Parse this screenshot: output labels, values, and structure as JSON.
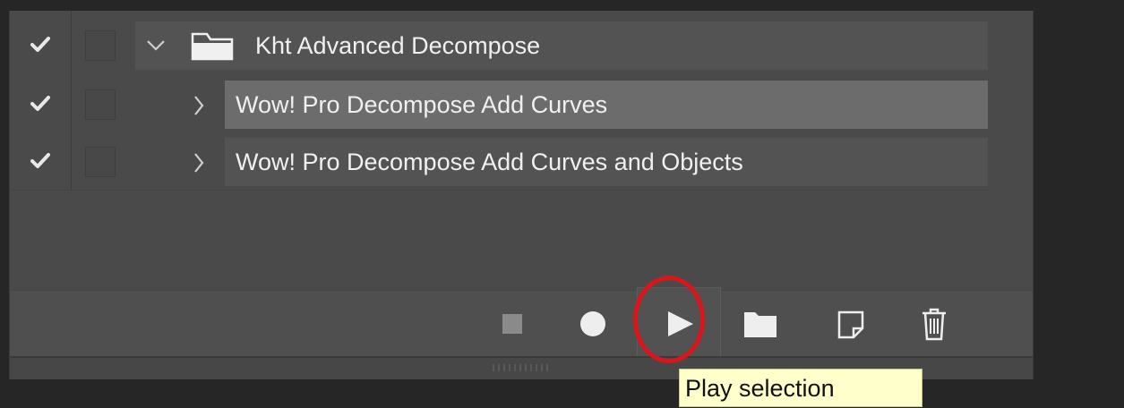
{
  "actions_panel": {
    "rows": [
      {
        "label": "Kht Advanced Decompose",
        "type": "set",
        "expanded": true,
        "checked": true,
        "selected": false
      },
      {
        "label": "Wow! Pro Decompose Add Curves",
        "type": "action",
        "expanded": false,
        "checked": true,
        "selected": true
      },
      {
        "label": "Wow! Pro Decompose Add Curves and Objects",
        "type": "action",
        "expanded": false,
        "checked": true,
        "selected": false
      }
    ],
    "toolbar": {
      "buttons": [
        {
          "name": "stop-icon",
          "enabled": false
        },
        {
          "name": "record-icon",
          "enabled": true
        },
        {
          "name": "play-icon",
          "enabled": true
        },
        {
          "name": "new-set-folder-icon",
          "enabled": true
        },
        {
          "name": "new-action-icon",
          "enabled": true
        },
        {
          "name": "trash-icon",
          "enabled": true
        }
      ]
    }
  },
  "tooltip": {
    "text": "Play selection"
  },
  "colors": {
    "panel_bg": "#4a4a4a",
    "selected_row": "#6c6c6c",
    "highlight_circle": "#d9161b",
    "tooltip_bg": "#ffffcc"
  }
}
